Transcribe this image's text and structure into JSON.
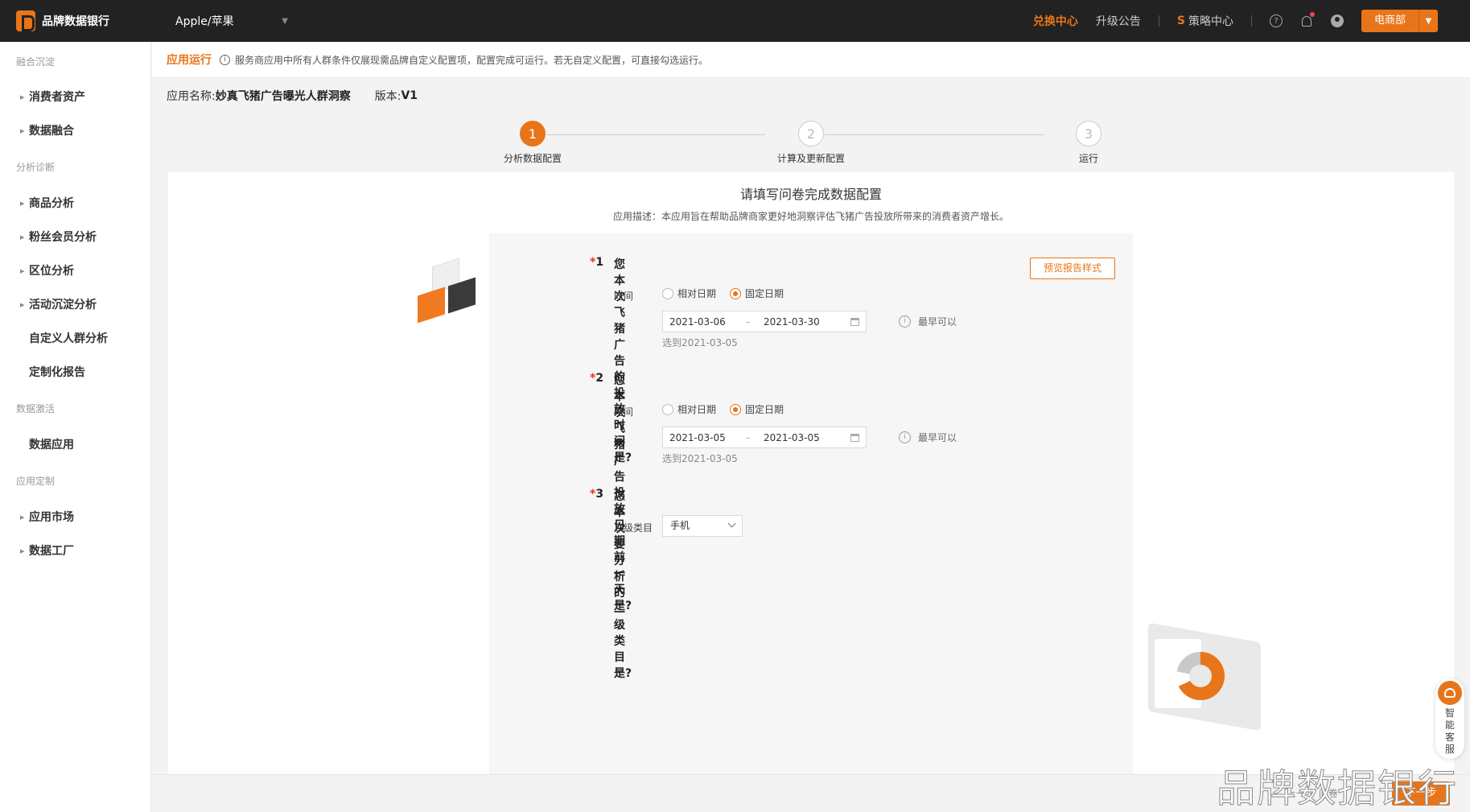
{
  "topbar": {
    "logo_text": "品牌数据银行",
    "brand_selector": "Apple/苹果",
    "links": [
      "兑换中心",
      "升级公告"
    ],
    "strategy": "策略中心",
    "department_button": "电商部"
  },
  "sidebar": {
    "groups": [
      {
        "label": "融合沉淀",
        "items": [
          {
            "label": "消费者资产",
            "expandable": true
          },
          {
            "label": "数据融合",
            "expandable": true
          }
        ]
      },
      {
        "label": "分析诊断",
        "items": [
          {
            "label": "商品分析",
            "expandable": true
          },
          {
            "label": "粉丝会员分析",
            "expandable": true
          },
          {
            "label": "区位分析",
            "expandable": true
          },
          {
            "label": "活动沉淀分析",
            "expandable": true
          },
          {
            "label": "自定义人群分析",
            "expandable": false
          },
          {
            "label": "定制化报告",
            "expandable": false
          }
        ]
      },
      {
        "label": "数据激活",
        "items": [
          {
            "label": "数据应用",
            "expandable": false
          }
        ]
      },
      {
        "label": "应用定制",
        "items": [
          {
            "label": "应用市场",
            "expandable": true
          },
          {
            "label": "数据工厂",
            "expandable": true
          }
        ]
      }
    ]
  },
  "app_run": {
    "title": "应用运行",
    "description": "服务商应用中所有人群条件仅展现需品牌自定义配置项，配置完成可运行。若无自定义配置，可直接勾选运行。"
  },
  "app_info": {
    "name_label": "应用名称:",
    "name_value": "妙真飞猪广告曝光人群洞察",
    "version_label": "版本:",
    "version_value": "V1"
  },
  "steps": [
    {
      "num": "1",
      "label": "分析数据配置",
      "active": true
    },
    {
      "num": "2",
      "label": "计算及更新配置",
      "active": false
    },
    {
      "num": "3",
      "label": "运行",
      "active": false
    }
  ],
  "card": {
    "title": "请填写问卷完成数据配置",
    "description": "应用描述：本应用旨在帮助品牌商家更好地洞察评估飞猪广告投放所带来的消费者资产增长。",
    "preview_button": "预览报告样式"
  },
  "questions": [
    {
      "num": "1",
      "text": "您本次飞猪广告的投放时间是?",
      "row_label": "时间",
      "options": [
        "相对日期",
        "固定日期"
      ],
      "selected": "固定日期",
      "start_date": "2021-03-06",
      "end_date": "2021-03-30",
      "separator": "–",
      "tip": "最早可以",
      "hint": "选到2021-03-05"
    },
    {
      "num": "2",
      "text": "您本次飞猪广告投放日期前一天是?",
      "row_label": "时间",
      "options": [
        "相对日期",
        "固定日期"
      ],
      "selected": "固定日期",
      "start_date": "2021-03-05",
      "end_date": "2021-03-05",
      "separator": "–",
      "tip": "最早可以",
      "hint": "选到2021-03-05"
    },
    {
      "num": "3",
      "text": "您本次要分析的二级类目是?",
      "row_label": "二级类目",
      "select_value": "手机"
    }
  ],
  "bottom": {
    "secondary_text": "上一步  问卷",
    "next_button": "下一步"
  },
  "watermark": "品牌数据银行",
  "service_widget": "智能客服",
  "colors": {
    "accent": "#e8751a",
    "topbar": "#222222",
    "required": "#e8351a"
  }
}
